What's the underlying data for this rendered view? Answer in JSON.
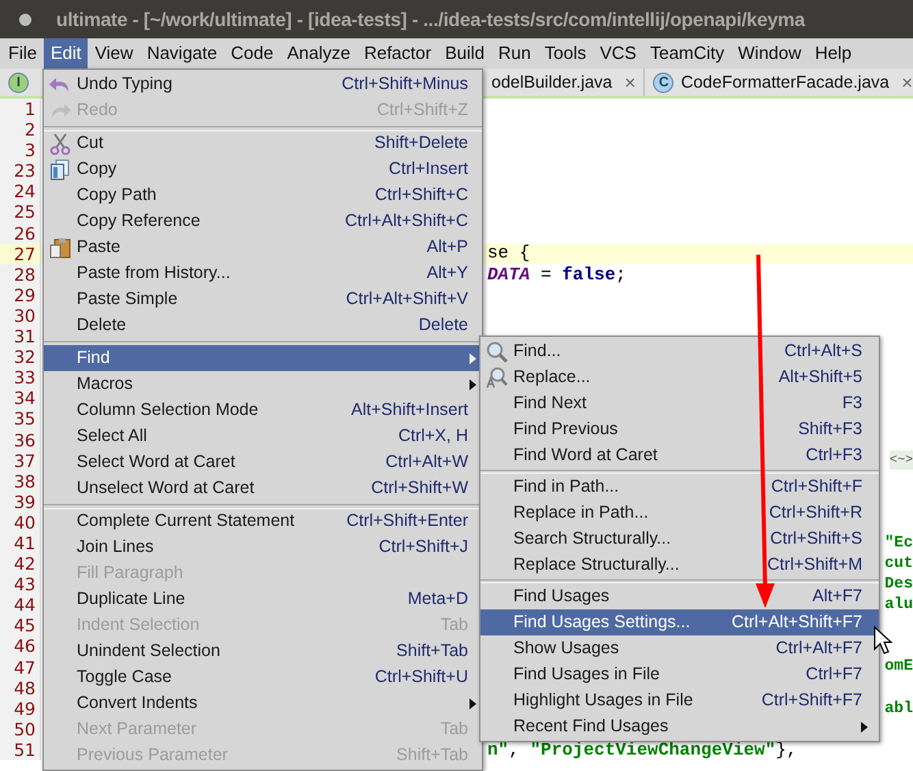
{
  "window": {
    "title": "ultimate - [~/work/ultimate] - [idea-tests] - .../idea-tests/src/com/intellij/openapi/keyma"
  },
  "menubar": [
    {
      "label": "File",
      "selected": false
    },
    {
      "label": "Edit",
      "selected": true
    },
    {
      "label": "View",
      "selected": false
    },
    {
      "label": "Navigate",
      "selected": false
    },
    {
      "label": "Code",
      "selected": false
    },
    {
      "label": "Analyze",
      "selected": false
    },
    {
      "label": "Refactor",
      "selected": false
    },
    {
      "label": "Build",
      "selected": false
    },
    {
      "label": "Run",
      "selected": false
    },
    {
      "label": "Tools",
      "selected": false
    },
    {
      "label": "VCS",
      "selected": false
    },
    {
      "label": "TeamCity",
      "selected": false
    },
    {
      "label": "Window",
      "selected": false
    },
    {
      "label": "Help",
      "selected": false
    }
  ],
  "tabs": [
    {
      "icon_letter": "I",
      "color": "#9ccf7a"
    },
    {
      "label": "odelBuilder.java",
      "close": "×"
    },
    {
      "icon_letter": "C",
      "color": "#a9d1f0",
      "label": "CodeFormatterFacade.java",
      "close": "×"
    }
  ],
  "editor": {
    "lines": [
      {
        "number": "1",
        "current": false
      },
      {
        "number": "2",
        "current": false
      },
      {
        "number": "3",
        "current": false
      },
      {
        "number": "23",
        "current": false
      },
      {
        "number": "24",
        "current": false
      },
      {
        "number": "25",
        "current": false
      },
      {
        "number": "26",
        "current": false
      },
      {
        "number": "27",
        "current": true,
        "segments": [
          {
            "kind": "plain",
            "text": "se {"
          }
        ]
      },
      {
        "number": "28",
        "current": false,
        "segments": [
          {
            "kind": "field",
            "text": "DATA"
          },
          {
            "kind": "plain",
            "text": " = "
          },
          {
            "kind": "keyword",
            "text": "false"
          },
          {
            "kind": "plain",
            "text": ";"
          }
        ]
      },
      {
        "number": "29",
        "current": false
      },
      {
        "number": "30",
        "current": false
      },
      {
        "number": "31",
        "current": false
      },
      {
        "number": "32",
        "current": false
      },
      {
        "number": "33",
        "current": false
      },
      {
        "number": "34",
        "current": false
      },
      {
        "number": "35",
        "current": false
      },
      {
        "number": "36",
        "current": false
      },
      {
        "number": "37",
        "current": false,
        "edge": [
          {
            "kind": "fold",
            "text": "<~>"
          }
        ]
      },
      {
        "number": "38",
        "current": false
      },
      {
        "number": "39",
        "current": false
      },
      {
        "number": "40",
        "current": false
      },
      {
        "number": "41",
        "current": false,
        "edge": [
          {
            "kind": "string",
            "text": "\"Ec"
          }
        ]
      },
      {
        "number": "42",
        "current": false,
        "edge": [
          {
            "kind": "string",
            "text": "cut"
          }
        ]
      },
      {
        "number": "43",
        "current": false,
        "edge": [
          {
            "kind": "string",
            "text": "Des"
          }
        ]
      },
      {
        "number": "44",
        "current": false,
        "edge": [
          {
            "kind": "string",
            "text": "alu"
          }
        ]
      },
      {
        "number": "45",
        "current": false
      },
      {
        "number": "46",
        "current": false
      },
      {
        "number": "47",
        "current": false,
        "edge": [
          {
            "kind": "string",
            "text": "omE"
          }
        ]
      },
      {
        "number": "48",
        "current": false
      },
      {
        "number": "49",
        "current": false,
        "edge": [
          {
            "kind": "string",
            "text": "abl"
          }
        ]
      },
      {
        "number": "50",
        "current": false
      },
      {
        "number": "51",
        "current": false,
        "segments": [
          {
            "kind": "string",
            "text": "n\""
          },
          {
            "kind": "plain",
            "text": ", "
          },
          {
            "kind": "string",
            "text": "\"ProjectViewChangeView\""
          },
          {
            "kind": "plain",
            "text": "},"
          }
        ]
      }
    ]
  },
  "edit_menu": {
    "items": [
      {
        "kind": "item",
        "label": "Undo Typing",
        "shortcut": "Ctrl+Shift+Minus",
        "disabled": false,
        "selected": false
      },
      {
        "kind": "item",
        "label": "Redo",
        "shortcut": "Ctrl+Shift+Z",
        "disabled": true,
        "selected": false
      },
      {
        "kind": "separator"
      },
      {
        "kind": "item",
        "label": "Cut",
        "shortcut": "Shift+Delete",
        "disabled": false,
        "selected": false
      },
      {
        "kind": "item",
        "label": "Copy",
        "shortcut": "Ctrl+Insert",
        "disabled": false,
        "selected": false
      },
      {
        "kind": "item",
        "label": "Copy Path",
        "shortcut": "Ctrl+Shift+C",
        "disabled": false,
        "selected": false
      },
      {
        "kind": "item",
        "label": "Copy Reference",
        "shortcut": "Ctrl+Alt+Shift+C",
        "disabled": false,
        "selected": false
      },
      {
        "kind": "item",
        "label": "Paste",
        "shortcut": "Alt+P",
        "disabled": false,
        "selected": false
      },
      {
        "kind": "item",
        "label": "Paste from History...",
        "shortcut": "Alt+Y",
        "disabled": false,
        "selected": false
      },
      {
        "kind": "item",
        "label": "Paste Simple",
        "shortcut": "Ctrl+Alt+Shift+V",
        "disabled": false,
        "selected": false
      },
      {
        "kind": "item",
        "label": "Delete",
        "shortcut": "Delete",
        "disabled": false,
        "selected": false
      },
      {
        "kind": "separator"
      },
      {
        "kind": "submenu",
        "label": "Find",
        "disabled": false,
        "selected": true
      },
      {
        "kind": "submenu",
        "label": "Macros",
        "disabled": false,
        "selected": false
      },
      {
        "kind": "item",
        "label": "Column Selection Mode",
        "shortcut": "Alt+Shift+Insert",
        "disabled": false,
        "selected": false
      },
      {
        "kind": "item",
        "label": "Select All",
        "shortcut": "Ctrl+X, H",
        "disabled": false,
        "selected": false
      },
      {
        "kind": "item",
        "label": "Select Word at Caret",
        "shortcut": "Ctrl+Alt+W",
        "disabled": false,
        "selected": false
      },
      {
        "kind": "item",
        "label": "Unselect Word at Caret",
        "shortcut": "Ctrl+Shift+W",
        "disabled": false,
        "selected": false
      },
      {
        "kind": "separator"
      },
      {
        "kind": "item",
        "label": "Complete Current Statement",
        "shortcut": "Ctrl+Shift+Enter",
        "disabled": false,
        "selected": false
      },
      {
        "kind": "item",
        "label": "Join Lines",
        "shortcut": "Ctrl+Shift+J",
        "disabled": false,
        "selected": false
      },
      {
        "kind": "item",
        "label": "Fill Paragraph",
        "disabled": true,
        "selected": false
      },
      {
        "kind": "item",
        "label": "Duplicate Line",
        "shortcut": "Meta+D",
        "disabled": false,
        "selected": false
      },
      {
        "kind": "item",
        "label": "Indent Selection",
        "shortcut": "Tab",
        "disabled": true,
        "selected": false
      },
      {
        "kind": "item",
        "label": "Unindent Selection",
        "shortcut": "Shift+Tab",
        "disabled": false,
        "selected": false
      },
      {
        "kind": "item",
        "label": "Toggle Case",
        "shortcut": "Ctrl+Shift+U",
        "disabled": false,
        "selected": false
      },
      {
        "kind": "submenu",
        "label": "Convert Indents",
        "disabled": false,
        "selected": false
      },
      {
        "kind": "item",
        "label": "Next Parameter",
        "shortcut": "Tab",
        "disabled": true,
        "selected": false
      },
      {
        "kind": "item",
        "label": "Previous Parameter",
        "shortcut": "Shift+Tab",
        "disabled": true,
        "selected": false
      }
    ]
  },
  "find_submenu": {
    "items": [
      {
        "kind": "item",
        "label": "Find...",
        "shortcut": "Ctrl+Alt+S",
        "disabled": false,
        "selected": false
      },
      {
        "kind": "item",
        "label": "Replace...",
        "shortcut": "Alt+Shift+5",
        "disabled": false,
        "selected": false
      },
      {
        "kind": "item",
        "label": "Find Next",
        "shortcut": "F3",
        "disabled": false,
        "selected": false
      },
      {
        "kind": "item",
        "label": "Find Previous",
        "shortcut": "Shift+F3",
        "disabled": false,
        "selected": false
      },
      {
        "kind": "item",
        "label": "Find Word at Caret",
        "shortcut": "Ctrl+F3",
        "disabled": false,
        "selected": false
      },
      {
        "kind": "separator"
      },
      {
        "kind": "item",
        "label": "Find in Path...",
        "shortcut": "Ctrl+Shift+F",
        "disabled": false,
        "selected": false
      },
      {
        "kind": "item",
        "label": "Replace in Path...",
        "shortcut": "Ctrl+Shift+R",
        "disabled": false,
        "selected": false
      },
      {
        "kind": "item",
        "label": "Search Structurally...",
        "shortcut": "Ctrl+Shift+S",
        "disabled": false,
        "selected": false
      },
      {
        "kind": "item",
        "label": "Replace Structurally...",
        "shortcut": "Ctrl+Shift+M",
        "disabled": false,
        "selected": false
      },
      {
        "kind": "separator"
      },
      {
        "kind": "item",
        "label": "Find Usages",
        "shortcut": "Alt+F7",
        "disabled": false,
        "selected": false
      },
      {
        "kind": "item",
        "label": "Find Usages Settings...",
        "shortcut": "Ctrl+Alt+Shift+F7",
        "disabled": false,
        "selected": true
      },
      {
        "kind": "item",
        "label": "Show Usages",
        "shortcut": "Ctrl+Alt+F7",
        "disabled": false,
        "selected": false
      },
      {
        "kind": "item",
        "label": "Find Usages in File",
        "shortcut": "Ctrl+F7",
        "disabled": false,
        "selected": false
      },
      {
        "kind": "item",
        "label": "Highlight Usages in File",
        "shortcut": "Ctrl+Shift+F7",
        "disabled": false,
        "selected": false
      },
      {
        "kind": "submenu",
        "label": "Recent Find Usages",
        "disabled": false,
        "selected": false
      }
    ]
  }
}
